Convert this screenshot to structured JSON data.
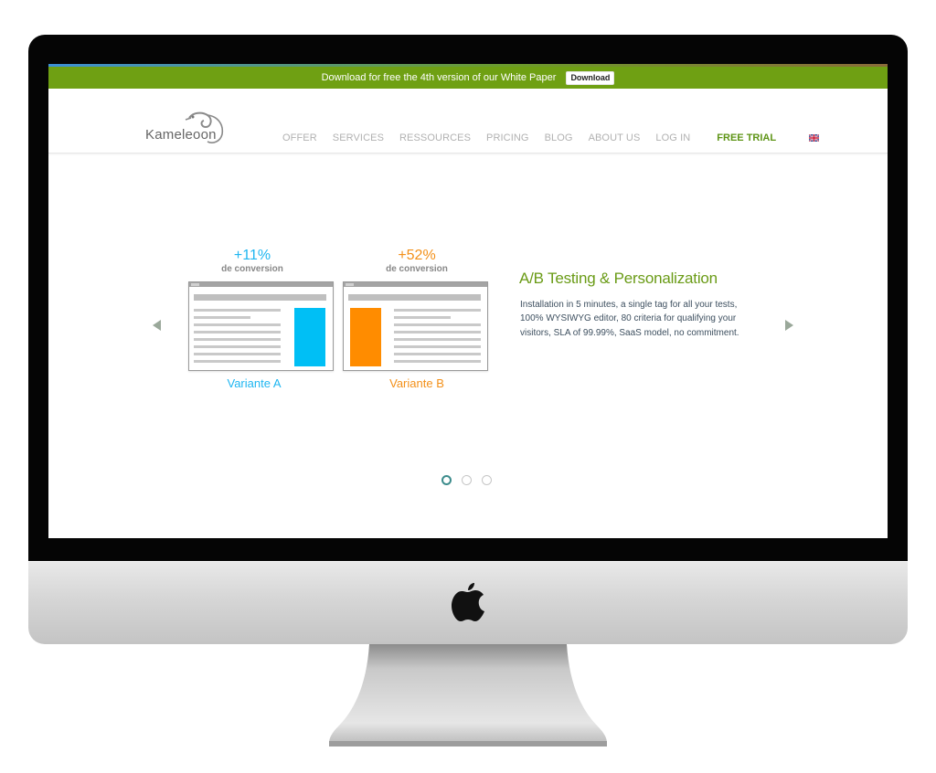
{
  "promo": {
    "text": "Download for free the 4th version of our White Paper",
    "button": "Download"
  },
  "logo": {
    "text": "Kameleoon"
  },
  "nav": {
    "items": [
      "OFFER",
      "SERVICES",
      "RESSOURCES",
      "PRICING",
      "BLOG",
      "ABOUT US",
      "LOG IN"
    ],
    "trial": "FREE TRIAL",
    "language_icon": "uk-flag-icon"
  },
  "slider": {
    "variant_a": {
      "stat": "+11%",
      "stat_label": "de conversion",
      "label": "Variante A",
      "color": "#1fb6f1"
    },
    "variant_b": {
      "stat": "+52%",
      "stat_label": "de conversion",
      "label": "Variante B",
      "color": "#f39019"
    },
    "title": "A/B Testing & Personalization",
    "description": "Installation in 5 minutes, a single tag for all your tests, 100% WYSIWYG editor, 80 criteria for qualifying your visitors, SLA of 99.99%, SaaS model, no commitment.",
    "slide_count": 3,
    "active_slide": 1,
    "prev_icon": "arrow-left-icon",
    "next_icon": "arrow-right-icon"
  },
  "colors": {
    "brand_green": "#6fa013",
    "title_green": "#6a9b16",
    "text": "#3d4f5f"
  },
  "device": {
    "icon": "apple-logo-icon"
  }
}
